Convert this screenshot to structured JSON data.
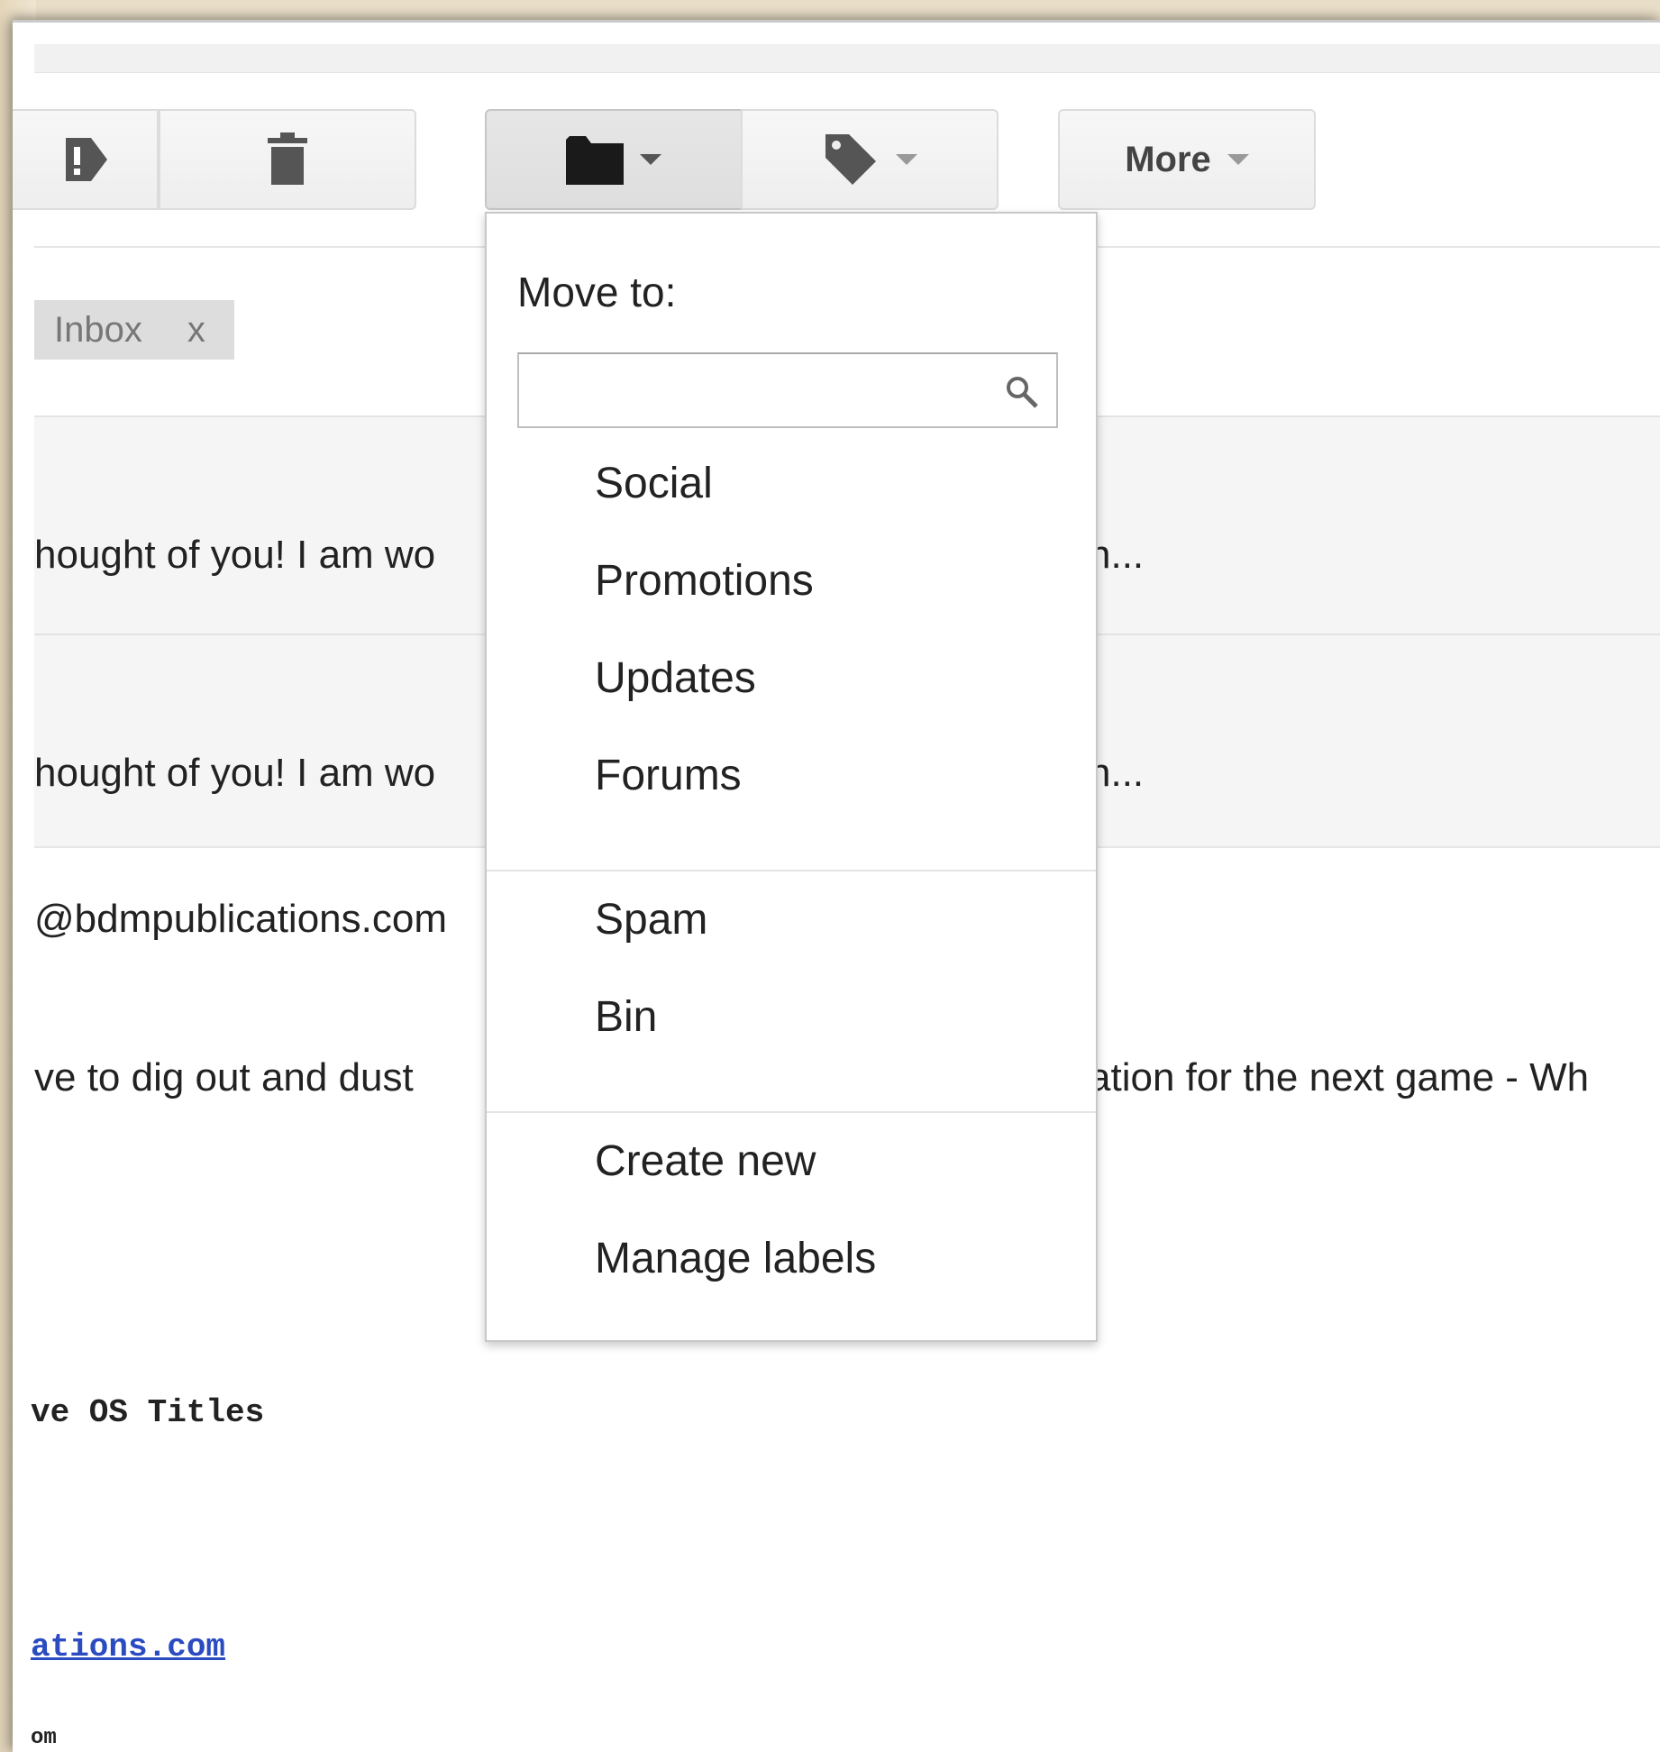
{
  "toolbar": {
    "more_label": "More"
  },
  "filter_chip": {
    "label": "Inbox",
    "close": "x"
  },
  "background_text": {
    "row1_left": "hought of you! I am wo",
    "row1_right": "h...",
    "row2_left": "hought of you! I am wo",
    "row2_right": "h...",
    "email": "@bdmpublications.com",
    "line_left": "ve to dig out and dust",
    "line_right": "ation for the next game - Wh",
    "mono_titles": "ve OS Titles",
    "mono_link": "ations.com",
    "mono_frag": "om"
  },
  "move_menu": {
    "title": "Move to:",
    "search_value": "",
    "search_placeholder": "",
    "categories": [
      "Social",
      "Promotions",
      "Updates",
      "Forums"
    ],
    "folders": [
      "Spam",
      "Bin"
    ],
    "actions": [
      "Create new",
      "Manage labels"
    ]
  },
  "icons": {
    "report": "report-spam-icon",
    "delete": "trash-icon",
    "move": "folder-icon",
    "labels": "label-tag-icon",
    "search": "search-icon"
  }
}
